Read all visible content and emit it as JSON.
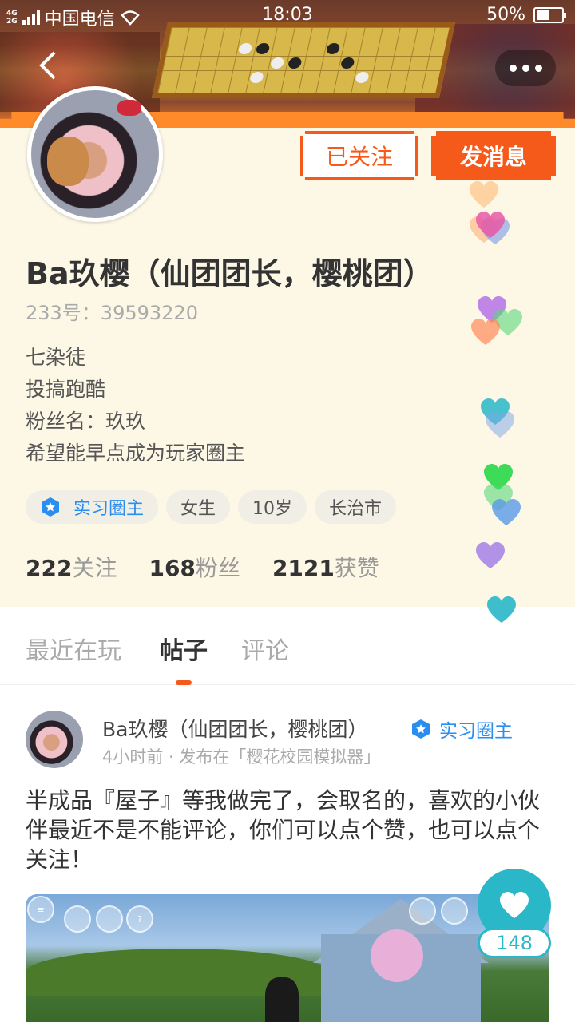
{
  "status_bar": {
    "carrier": "中国电信",
    "net_top": "4G",
    "net_bottom": "2G",
    "time": "18:03",
    "battery_percent_label": "50%",
    "battery_level": 0.5
  },
  "profile": {
    "follow_button": "已关注",
    "message_button": "发消息",
    "name": "Ba玖樱（仙团团长，樱桃团）",
    "uid": "233号：39593220",
    "bio": [
      "七染徒",
      "投搞跑酷",
      "粉丝名：玖玖",
      "希望能早点成为玩家圈主"
    ],
    "tags": [
      "实习圈主",
      "女生",
      "10岁",
      "长治市"
    ],
    "stats": [
      {
        "value": "222",
        "label": "关注"
      },
      {
        "value": "168",
        "label": "粉丝"
      },
      {
        "value": "2121",
        "label": "获赞"
      }
    ]
  },
  "tabs": [
    "最近在玩",
    "帖子",
    "评论"
  ],
  "active_tab": "帖子",
  "post": {
    "author": "Ba玖樱（仙团团长，樱桃团）",
    "badge": "实习圈主",
    "meta": "4小时前 · 发布在「樱花校园模拟器」",
    "text": "半成品『屋子』等我做完了，会取名的，喜欢的小伙伴最近不是不能评论，你们可以点个赞，也可以点个关注！",
    "likes": "148"
  },
  "colors": {
    "accent": "#f55a1a",
    "blue": "#2a8ef0",
    "teal": "#2ab8c8",
    "background": "#fdf7e6"
  }
}
